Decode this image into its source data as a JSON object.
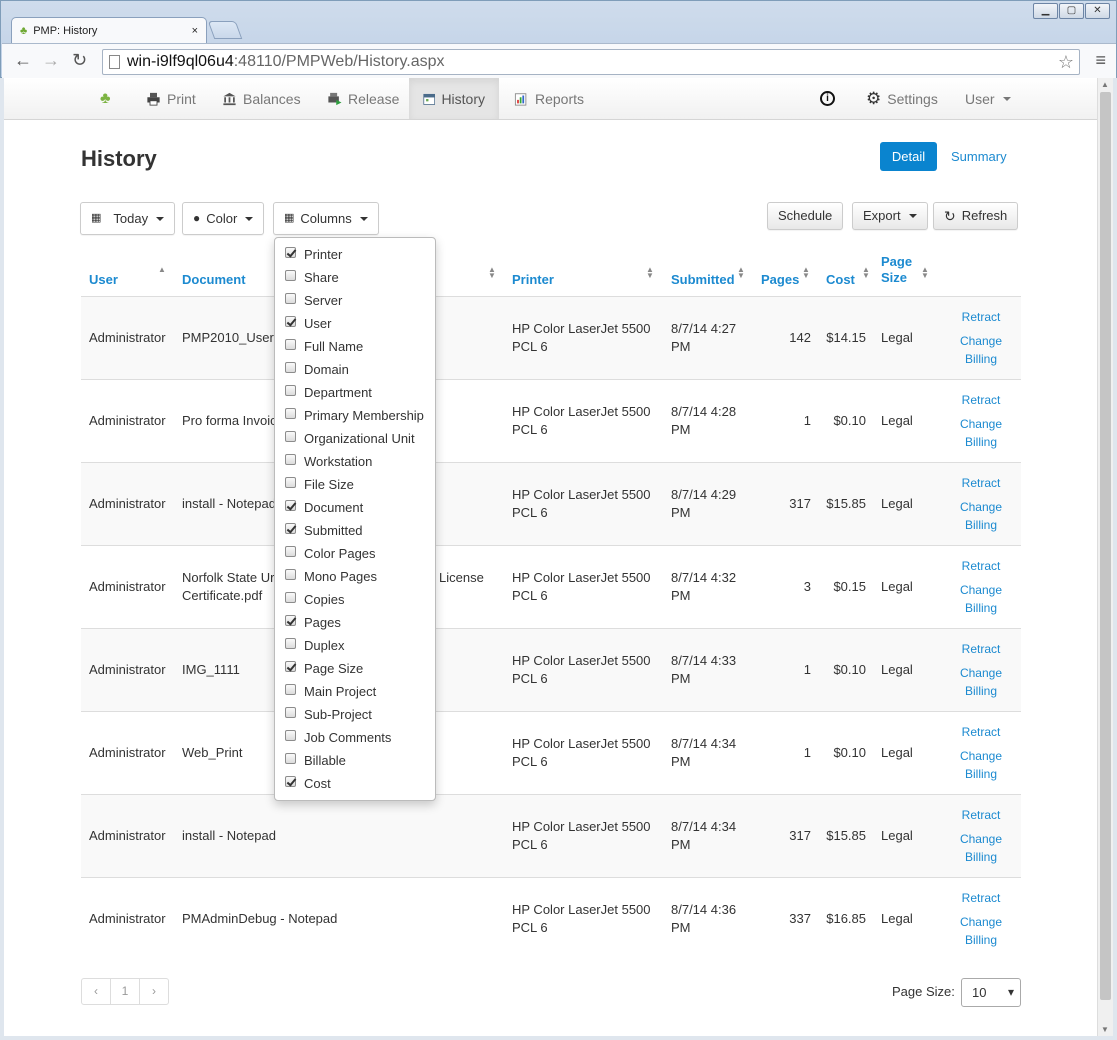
{
  "browser": {
    "tab_title": "PMP: History",
    "tab_close": "×",
    "url_host": "win-i9lf9ql06u4",
    "url_rest": ":48110/PMPWeb/History.aspx"
  },
  "navbar": {
    "print": "Print",
    "balances": "Balances",
    "release": "Release",
    "history": "History",
    "reports": "Reports",
    "settings": "Settings",
    "user": "User"
  },
  "page": {
    "title": "History",
    "detail_label": "Detail",
    "summary_label": "Summary"
  },
  "filters": {
    "today": "Today",
    "color": "Color",
    "columns": "Columns",
    "schedule": "Schedule",
    "export": "Export",
    "refresh": "Refresh"
  },
  "columns_menu": [
    {
      "label": "Printer",
      "checked": true
    },
    {
      "label": "Share",
      "checked": false
    },
    {
      "label": "Server",
      "checked": false
    },
    {
      "label": "User",
      "checked": true
    },
    {
      "label": "Full Name",
      "checked": false
    },
    {
      "label": "Domain",
      "checked": false
    },
    {
      "label": "Department",
      "checked": false
    },
    {
      "label": "Primary Membership",
      "checked": false
    },
    {
      "label": "Organizational Unit",
      "checked": false
    },
    {
      "label": "Workstation",
      "checked": false
    },
    {
      "label": "File Size",
      "checked": false
    },
    {
      "label": "Document",
      "checked": true
    },
    {
      "label": "Submitted",
      "checked": true
    },
    {
      "label": "Color Pages",
      "checked": false
    },
    {
      "label": "Mono Pages",
      "checked": false
    },
    {
      "label": "Copies",
      "checked": false
    },
    {
      "label": "Pages",
      "checked": true
    },
    {
      "label": "Duplex",
      "checked": false
    },
    {
      "label": "Page Size",
      "checked": true
    },
    {
      "label": "Main Project",
      "checked": false
    },
    {
      "label": "Sub-Project",
      "checked": false
    },
    {
      "label": "Job Comments",
      "checked": false
    },
    {
      "label": "Billable",
      "checked": false
    },
    {
      "label": "Cost",
      "checked": true
    }
  ],
  "table": {
    "headers": {
      "user": "User",
      "document": "Document",
      "printer": "Printer",
      "submitted": "Submitted",
      "pages": "Pages",
      "cost": "Cost",
      "page_size_1": "Page",
      "page_size_2": "Size"
    },
    "actions": {
      "retract": "Retract",
      "change_1": "Change",
      "change_2": "Billing"
    },
    "rows": [
      {
        "user": "Administrator",
        "doc1": "PMP2010_User",
        "doc2": "",
        "printer1": "HP Color LaserJet 5500",
        "printer2": "PCL 6",
        "sub1": "8/7/14 4:27",
        "sub2": "PM",
        "pages": "142",
        "cost": "$14.15",
        "size": "Legal"
      },
      {
        "user": "Administrator",
        "doc1": "Pro forma Invoic",
        "doc2": "",
        "printer1": "HP Color LaserJet 5500",
        "printer2": "PCL 6",
        "sub1": "8/7/14 4:28",
        "sub2": "PM",
        "pages": "1",
        "cost": "$0.10",
        "size": "Legal"
      },
      {
        "user": "Administrator",
        "doc1": "install - Notepad",
        "doc2": "",
        "printer1": "HP Color LaserJet 5500",
        "printer2": "PCL 6",
        "sub1": "8/7/14 4:29",
        "sub2": "PM",
        "pages": "317",
        "cost": "$15.85",
        "size": "Legal"
      },
      {
        "user": "Administrator",
        "doc1": "Norfolk State Ur",
        "doc1b": "License",
        "doc2": "Certificate.pdf",
        "printer1": "HP Color LaserJet 5500",
        "printer2": "PCL 6",
        "sub1": "8/7/14 4:32",
        "sub2": "PM",
        "pages": "3",
        "cost": "$0.15",
        "size": "Legal"
      },
      {
        "user": "Administrator",
        "doc1": "IMG_1111",
        "doc2": "",
        "printer1": "HP Color LaserJet 5500",
        "printer2": "PCL 6",
        "sub1": "8/7/14 4:33",
        "sub2": "PM",
        "pages": "1",
        "cost": "$0.10",
        "size": "Legal"
      },
      {
        "user": "Administrator",
        "doc1": "Web_Print",
        "doc2": "",
        "printer1": "HP Color LaserJet 5500",
        "printer2": "PCL 6",
        "sub1": "8/7/14 4:34",
        "sub2": "PM",
        "pages": "1",
        "cost": "$0.10",
        "size": "Legal"
      },
      {
        "user": "Administrator",
        "doc1": "install - Notepad",
        "doc2": "",
        "printer1": "HP Color LaserJet 5500",
        "printer2": "PCL 6",
        "sub1": "8/7/14 4:34",
        "sub2": "PM",
        "pages": "317",
        "cost": "$15.85",
        "size": "Legal"
      },
      {
        "user": "Administrator",
        "doc1": "PMAdminDebug - Notepad",
        "doc2": "",
        "printer1": "HP Color LaserJet 5500",
        "printer2": "PCL 6",
        "sub1": "8/7/14 4:36",
        "sub2": "PM",
        "pages": "337",
        "cost": "$16.85",
        "size": "Legal"
      }
    ]
  },
  "pager": {
    "prev": "‹",
    "current": "1",
    "next": "›",
    "page_size_label": "Page Size:",
    "page_size_value": "10"
  }
}
